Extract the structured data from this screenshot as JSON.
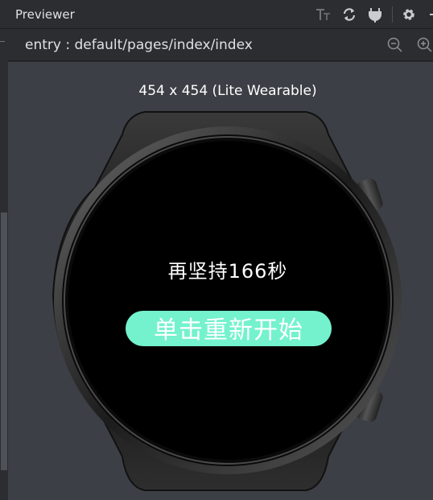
{
  "panel": {
    "title": "Previewer",
    "toolbar_icons": [
      "font-size-icon",
      "refresh-icon",
      "plug-icon",
      "gear-icon",
      "minimize-icon"
    ]
  },
  "path_bar": {
    "path": "entry : default/pages/index/index",
    "icons": [
      "zoom-out-icon",
      "zoom-in-icon"
    ]
  },
  "device": {
    "label": "454 x 454 (Lite Wearable)"
  },
  "watch_screen": {
    "message": "再坚持166秒",
    "button_label": "单击重新开始",
    "button_color": "#74f2cd"
  },
  "colors": {
    "panel_bg": "#2b2d30",
    "stage_bg": "#3c3f45",
    "screen_bg": "#000000"
  }
}
